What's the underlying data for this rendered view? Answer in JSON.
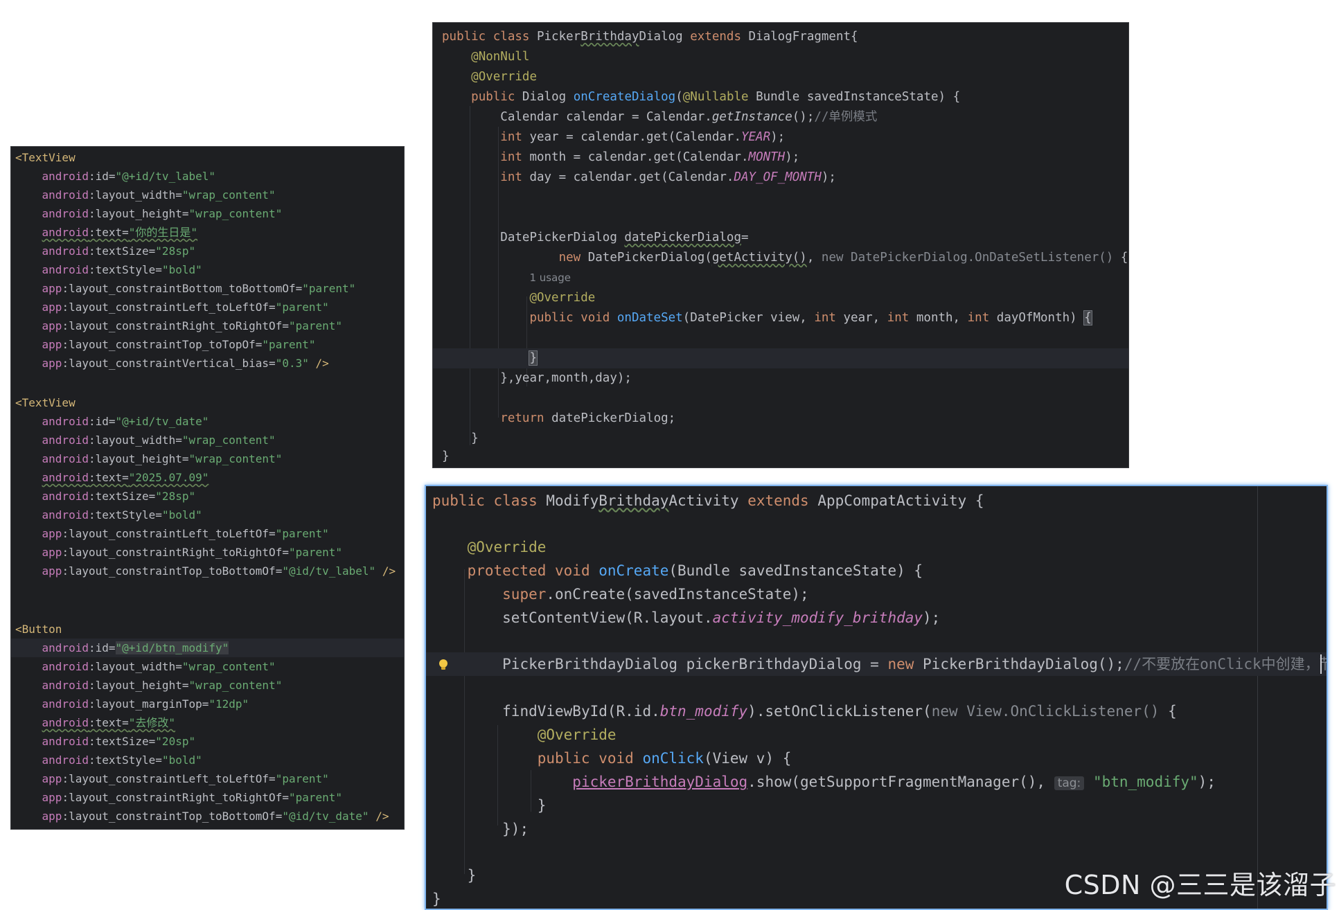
{
  "xml_panel": {
    "tv_label": {
      "tag": "<TextView",
      "ns_android": "android",
      "ns_app": "app",
      "id_attr": ":id=",
      "id_val": "\"@+id/tv_label\"",
      "w_attr": ":layout_width=",
      "w_val": "\"wrap_content\"",
      "h_attr": ":layout_height=",
      "h_val": "\"wrap_content\"",
      "text_attr": ":text=",
      "text_val": "\"你的生日是\"",
      "size_attr": ":textSize=",
      "size_val": "\"28sp\"",
      "style_attr": ":textStyle=",
      "style_val": "\"bold\"",
      "c1_attr": ":layout_constraintBottom_toBottomOf=",
      "c1_val": "\"parent\"",
      "c2_attr": ":layout_constraintLeft_toLeftOf=",
      "c2_val": "\"parent\"",
      "c3_attr": ":layout_constraintRight_toRightOf=",
      "c3_val": "\"parent\"",
      "c4_attr": ":layout_constraintTop_toTopOf=",
      "c4_val": "\"parent\"",
      "c5_attr": ":layout_constraintVertical_bias=",
      "c5_val": "\"0.3\"",
      "close": " />"
    },
    "tv_date": {
      "tag": "<TextView",
      "ns_android": "android",
      "ns_app": "app",
      "id_attr": ":id=",
      "id_val": "\"@+id/tv_date\"",
      "w_attr": ":layout_width=",
      "w_val": "\"wrap_content\"",
      "h_attr": ":layout_height=",
      "h_val": "\"wrap_content\"",
      "text_attr": ":text=",
      "text_val": "\"2025.07.09\"",
      "size_attr": ":textSize=",
      "size_val": "\"28sp\"",
      "style_attr": ":textStyle=",
      "style_val": "\"bold\"",
      "c1_attr": ":layout_constraintLeft_toLeftOf=",
      "c1_val": "\"parent\"",
      "c2_attr": ":layout_constraintRight_toRightOf=",
      "c2_val": "\"parent\"",
      "c3_attr": ":layout_constraintTop_toBottomOf=",
      "c3_val": "\"@id/tv_label\"",
      "close": " />"
    },
    "btn_modify": {
      "tag": "<Button",
      "ns_android": "android",
      "ns_app": "app",
      "id_attr": ":id=",
      "id_val": "\"@+id/btn_modify\"",
      "w_attr": ":layout_width=",
      "w_val": "\"wrap_content\"",
      "h_attr": ":layout_height=",
      "h_val": "\"wrap_content\"",
      "m_attr": ":layout_marginTop=",
      "m_val": "\"12dp\"",
      "text_attr": ":text=",
      "text_val": "\"去修改\"",
      "size_attr": ":textSize=",
      "size_val": "\"20sp\"",
      "style_attr": ":textStyle=",
      "style_val": "\"bold\"",
      "c1_attr": ":layout_constraintLeft_toLeftOf=",
      "c1_val": "\"parent\"",
      "c2_attr": ":layout_constraintRight_toRightOf=",
      "c2_val": "\"parent\"",
      "c3_attr": ":layout_constraintTop_toBottomOf=",
      "c3_val": "\"@id/tv_date\"",
      "close": " />"
    }
  },
  "java1": {
    "l1_kw": "public class ",
    "l1_name_a": "Picker",
    "l1_name_b": "Brithday",
    "l1_name_c": "Dialog",
    "l1_ext": " extends ",
    "l1_rest": "DialogFragment{",
    "l2": "@NonNull",
    "l3": "@Override",
    "l4_kw": "public ",
    "l4_type": "Dialog ",
    "l4_fn": "onCreateDialog",
    "l4_p1": "(",
    "l4_ann": "@Nullable",
    "l4_rest": " Bundle savedInstanceState) {",
    "l5_a": "Calendar calendar = Calendar.",
    "l5_it": "getInstance",
    "l5_b": "();",
    "l5_cm": "//单例模式",
    "l6_kw": "int",
    "l6_a": " year = calendar.get(Calendar.",
    "l6_c": "YEAR",
    "l6_b": ");",
    "l7_kw": "int",
    "l7_a": " month = calendar.get(Calendar.",
    "l7_c": "MONTH",
    "l7_b": ");",
    "l8_kw": "int",
    "l8_a": " day = calendar.get(Calendar.",
    "l8_c": "DAY_OF_MONTH",
    "l8_b": ");",
    "l9_a": "DatePickerDialog ",
    "l9_var": "datePickerDialog",
    "l9_b": "=",
    "l10_kw": "new ",
    "l10_a": "DatePickerDialog(",
    "l10_call": "getActivity()",
    "l10_b": ", ",
    "l10_gray": "new DatePickerDialog.OnDateSetListener() ",
    "l10_c": "{",
    "l11": "1 usage",
    "l12": "@Override",
    "l13_kw": "public void ",
    "l13_fn": "onDateSet",
    "l13_a": "(DatePicker view, ",
    "l13_k1": "int",
    "l13_b": " year, ",
    "l13_k2": "int",
    "l13_c": " month, ",
    "l13_k3": "int",
    "l13_d": " dayOfMonth) ",
    "l13_brace": "{",
    "l14": "}",
    "l15": "},year,month,day);",
    "l16_kw": "return ",
    "l16_a": "datePickerDialog;",
    "l17": "}",
    "l18": "}"
  },
  "java2": {
    "l1_kw": "public class ",
    "l1_a": "Modify",
    "l1_b": "Brithday",
    "l1_c": "Activity",
    "l1_ext": " extends ",
    "l1_rest": "AppCompatActivity {",
    "l2": "@Override",
    "l3_kw": "protected void ",
    "l3_fn": "onCreate",
    "l3_rest": "(Bundle savedInstanceState) {",
    "l4_kw": "super",
    "l4_rest": ".onCreate(savedInstanceState);",
    "l5_a": "setContentView(R.layout.",
    "l5_c": "activity_modify_brithday",
    "l5_b": ");",
    "l6_a": "PickerBrithdayDialog pickerBrithdayDialog = ",
    "l6_kw": "new",
    "l6_b": " PickerBrithdayDialog();",
    "l6_cm": "//不要放在onClick中创建，节约资源",
    "l7_a": "findViewById(R.id.",
    "l7_c": "btn_modify",
    "l7_b": ").setOnClickListener(",
    "l7_gray": "new View.OnClickListener() ",
    "l7_d": "{",
    "l8": "@Override",
    "l9_kw": "public void ",
    "l9_fn": "onClick",
    "l9_rest": "(View v) {",
    "l10_var": "pickerBrithdayDialog",
    "l10_a": ".show(getSupportFragmentManager(), ",
    "l10_hint": "tag:",
    "l10_str": " \"btn_modify\"",
    "l10_b": ");",
    "l11": "}",
    "l12": "});",
    "l13": "}",
    "l14": "}"
  },
  "watermark": "CSDN @三三是该溜子"
}
